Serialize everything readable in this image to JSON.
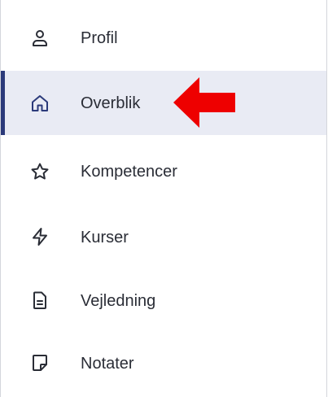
{
  "sidebar": {
    "items": [
      {
        "label": "Profil",
        "icon": "user-icon",
        "active": false
      },
      {
        "label": "Overblik",
        "icon": "home-icon",
        "active": true
      },
      {
        "label": "Kompetencer",
        "icon": "star-icon",
        "active": false
      },
      {
        "label": "Kurser",
        "icon": "lightning-icon",
        "active": false
      },
      {
        "label": "Vejledning",
        "icon": "document-icon",
        "active": false
      },
      {
        "label": "Notater",
        "icon": "note-icon",
        "active": false
      }
    ]
  },
  "colors": {
    "active_background": "#e9ebf4",
    "active_indicator": "#2b3a7a",
    "text": "#2a2d36",
    "annotation_arrow": "#ee0000"
  }
}
